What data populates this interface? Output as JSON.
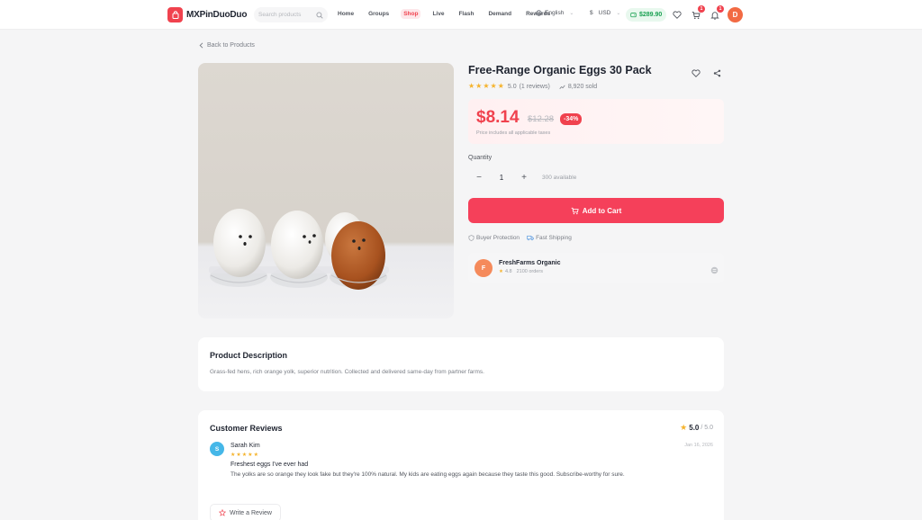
{
  "header": {
    "brand": "MXPinDuoDuo",
    "search_placeholder": "Search products",
    "nav": [
      {
        "label": "Home",
        "active": false
      },
      {
        "label": "Groups",
        "active": false
      },
      {
        "label": "Shop",
        "active": true
      },
      {
        "label": "Live",
        "active": false
      },
      {
        "label": "Flash",
        "active": false
      },
      {
        "label": "Demand",
        "active": false
      },
      {
        "label": "Rewards",
        "active": false
      }
    ],
    "language": "English",
    "currency": "USD",
    "balance": "$289.90",
    "cart_count": "1",
    "notification_count": "1",
    "user_initial": "D"
  },
  "back_link": "Back to Products",
  "product": {
    "title": "Free-Range Organic Eggs 30 Pack",
    "rating": "5.0",
    "review_count_text": "(1 reviews)",
    "sold_text": "8,920 sold",
    "price": "$8.14",
    "original_price": "$12.28",
    "discount": "-34%",
    "tax_note": "Price includes all applicable taxes",
    "quantity_label": "Quantity",
    "quantity": "1",
    "available_text": "300 available",
    "add_to_cart_label": "Add to Cart",
    "perks": [
      "Buyer Protection",
      "Fast Shipping"
    ]
  },
  "seller": {
    "initial": "F",
    "name": "FreshFarms Organic",
    "rating": "4.8",
    "orders_text": "2100 orders"
  },
  "description": {
    "heading": "Product Description",
    "text": "Grass-fed hens, rich orange yolk, superior nutrition. Collected and delivered same-day from partner farms."
  },
  "reviews": {
    "heading": "Customer Reviews",
    "overall_rating": "5.0",
    "overall_max": "/ 5.0",
    "items": [
      {
        "initial": "S",
        "name": "Sarah Kim",
        "date": "Jan 16, 2026",
        "stars": 5,
        "title": "Freshest eggs I've ever had",
        "body": "The yolks are so orange they look fake but they're 100% natural. My kids are eating eggs again because they taste this good. Subscribe-worthy for sure."
      }
    ],
    "write_review_label": "Write a Review"
  },
  "colors": {
    "accent": "#f0424e",
    "button": "#f5405a",
    "balance": "#1aa152",
    "star": "#f5b32c"
  }
}
